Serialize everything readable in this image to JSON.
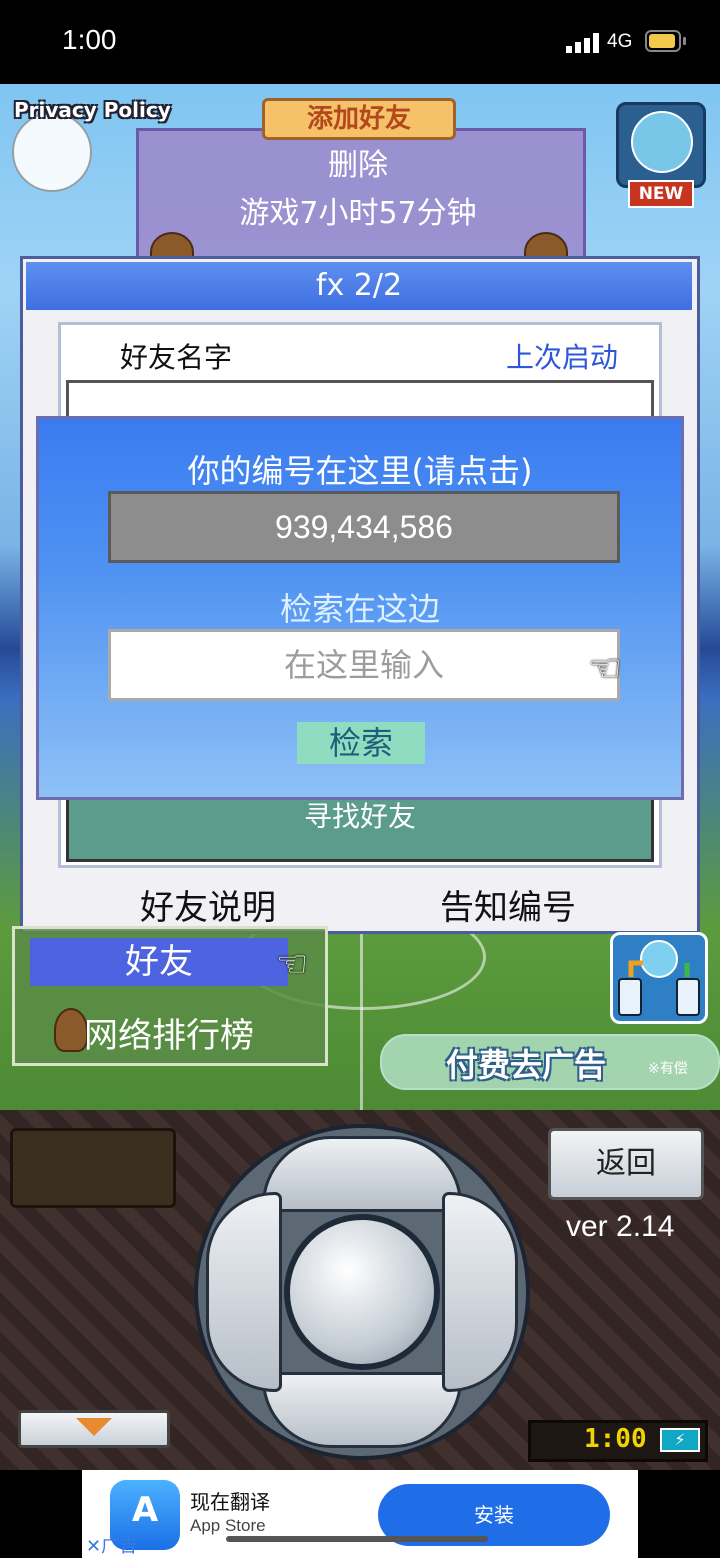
{
  "status_bar": {
    "time": "1:00",
    "network": "4G"
  },
  "top": {
    "privacy_policy": "Privacy Policy",
    "new_badge": "NEW"
  },
  "background_card": {
    "tab_label": "添加好友",
    "delete": "删除",
    "playtime": "游戏7小时57分钟"
  },
  "dialog": {
    "title": "fx 2/2",
    "header_name": "好友名字",
    "header_last_login": "上次启动",
    "find_friend": "寻找好友",
    "tab_explain": "好友说明",
    "tab_tell_id": "告知编号"
  },
  "id_panel": {
    "label": "你的编号在这里(请点击)",
    "my_id": "939,434,586",
    "search_label": "检索在这边",
    "search_placeholder": "在这里输入",
    "search_button": "检索",
    "pointer": "☜"
  },
  "menu": {
    "friend": "好友",
    "ranking": "网络排行榜",
    "pointer": "☜"
  },
  "remove_ads": {
    "label": "付费去广告",
    "note": "※有偿"
  },
  "device": {
    "back": "返回",
    "version": "ver 2.14",
    "clock": "1:00"
  },
  "ad": {
    "title": "现在翻译",
    "subtitle": "App Store",
    "install": "安装",
    "close": "✕广告",
    "icon_text": "A"
  },
  "colors": {
    "dialog_title": "#3e6fe0",
    "overlay": "#4f92f2",
    "menu_selected": "#4d63e0",
    "install": "#1f6ee8"
  }
}
